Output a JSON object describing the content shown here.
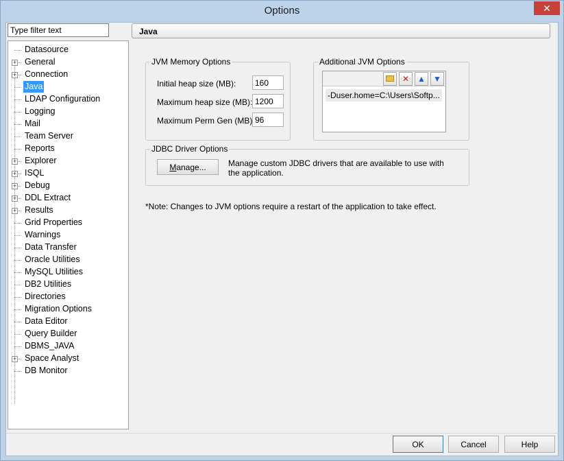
{
  "window": {
    "title": "Options",
    "close_glyph": "✕"
  },
  "filter": {
    "value": "Type filter text"
  },
  "tree": {
    "items": [
      {
        "label": "Datasource",
        "expandable": false,
        "selected": false
      },
      {
        "label": "General",
        "expandable": true,
        "selected": false
      },
      {
        "label": "Connection",
        "expandable": true,
        "selected": false
      },
      {
        "label": "Java",
        "expandable": false,
        "selected": true
      },
      {
        "label": "LDAP Configuration",
        "expandable": false,
        "selected": false
      },
      {
        "label": "Logging",
        "expandable": false,
        "selected": false
      },
      {
        "label": "Mail",
        "expandable": false,
        "selected": false
      },
      {
        "label": "Team Server",
        "expandable": false,
        "selected": false
      },
      {
        "label": "Reports",
        "expandable": false,
        "selected": false
      },
      {
        "label": "Explorer",
        "expandable": true,
        "selected": false
      },
      {
        "label": "ISQL",
        "expandable": true,
        "selected": false
      },
      {
        "label": "Debug",
        "expandable": true,
        "selected": false
      },
      {
        "label": "DDL Extract",
        "expandable": true,
        "selected": false
      },
      {
        "label": "Results",
        "expandable": true,
        "selected": false
      },
      {
        "label": "Grid Properties",
        "expandable": false,
        "selected": false
      },
      {
        "label": "Warnings",
        "expandable": false,
        "selected": false
      },
      {
        "label": "Data Transfer",
        "expandable": false,
        "selected": false
      },
      {
        "label": "Oracle Utilities",
        "expandable": false,
        "selected": false
      },
      {
        "label": "MySQL Utilities",
        "expandable": false,
        "selected": false
      },
      {
        "label": "DB2 Utilities",
        "expandable": false,
        "selected": false
      },
      {
        "label": "Directories",
        "expandable": false,
        "selected": false
      },
      {
        "label": "Migration Options",
        "expandable": false,
        "selected": false
      },
      {
        "label": "Data Editor",
        "expandable": false,
        "selected": false
      },
      {
        "label": "Query Builder",
        "expandable": false,
        "selected": false
      },
      {
        "label": "DBMS_JAVA",
        "expandable": false,
        "selected": false
      },
      {
        "label": "Space Analyst",
        "expandable": true,
        "selected": false
      },
      {
        "label": "DB Monitor",
        "expandable": false,
        "selected": false
      }
    ]
  },
  "panel": {
    "header": "Java",
    "jvm_memory": {
      "legend": "JVM Memory Options",
      "initial_label": "Initial heap size (MB):",
      "initial_value": "160",
      "max_label": "Maximum heap size (MB):",
      "max_value": "1200",
      "perm_label": "Maximum Perm Gen (MB):",
      "perm_value": "96"
    },
    "additional_jvm": {
      "legend": "Additional JVM Options",
      "items": [
        "-Duser.home=C:\\Users\\Softp..."
      ]
    },
    "jdbc": {
      "legend": "JDBC Driver Options",
      "manage_label": "Manage...",
      "description": "Manage custom JDBC drivers that are available to use with the application."
    },
    "note": "*Note: Changes to JVM options require a restart of the application to take effect."
  },
  "footer": {
    "ok_label": "OK",
    "cancel_label": "Cancel",
    "help_label": "Help"
  },
  "colors": {
    "selection": "#3399ff",
    "titlebar": "#bcd3ea",
    "close": "#c7403a"
  }
}
